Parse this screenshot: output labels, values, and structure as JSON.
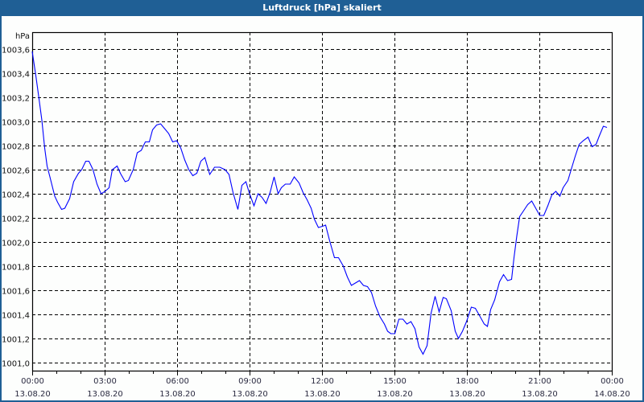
{
  "window": {
    "title": "Luftdruck [hPa] skaliert"
  },
  "colors": {
    "line": "#0000ff",
    "titlebar": "#1f5f95",
    "grid": "#000000"
  },
  "chart_data": {
    "type": "line",
    "title": "Luftdruck [hPa] skaliert",
    "ylabel": "hPa",
    "xlabel": "",
    "x_unit": "minutes since 13.08.20 00:00",
    "xlim": [
      0,
      1440
    ],
    "ylim": [
      1000.93,
      1003.74
    ],
    "grid": true,
    "yticks": [
      {
        "value": 1003.6,
        "label": "1003,6"
      },
      {
        "value": 1003.4,
        "label": "1003,4"
      },
      {
        "value": 1003.2,
        "label": "1003,2"
      },
      {
        "value": 1003.0,
        "label": "1003,0"
      },
      {
        "value": 1002.8,
        "label": "1002,8"
      },
      {
        "value": 1002.6,
        "label": "1002,6"
      },
      {
        "value": 1002.4,
        "label": "1002,4"
      },
      {
        "value": 1002.2,
        "label": "1002,2"
      },
      {
        "value": 1002.0,
        "label": "1002,0"
      },
      {
        "value": 1001.8,
        "label": "1001,8"
      },
      {
        "value": 1001.6,
        "label": "1001,6"
      },
      {
        "value": 1001.4,
        "label": "1001,4"
      },
      {
        "value": 1001.2,
        "label": "1001,2"
      },
      {
        "value": 1001.0,
        "label": "1001,0"
      }
    ],
    "xticks": [
      {
        "value": 0,
        "time": "00:00",
        "date": "13.08.20"
      },
      {
        "value": 180,
        "time": "03:00",
        "date": "13.08.20"
      },
      {
        "value": 360,
        "time": "06:00",
        "date": "13.08.20"
      },
      {
        "value": 540,
        "time": "09:00",
        "date": "13.08.20"
      },
      {
        "value": 720,
        "time": "12:00",
        "date": "13.08.20"
      },
      {
        "value": 900,
        "time": "15:00",
        "date": "13.08.20"
      },
      {
        "value": 1080,
        "time": "18:00",
        "date": "13.08.20"
      },
      {
        "value": 1260,
        "time": "21:00",
        "date": "13.08.20"
      },
      {
        "value": 1440,
        "time": "00:00",
        "date": "14.08.20"
      }
    ],
    "series": [
      {
        "name": "Luftdruck",
        "points": [
          [
            0,
            1003.58
          ],
          [
            9,
            1003.38
          ],
          [
            16,
            1003.21
          ],
          [
            24,
            1003.01
          ],
          [
            31,
            1002.78
          ],
          [
            37,
            1002.63
          ],
          [
            44,
            1002.54
          ],
          [
            56,
            1002.38
          ],
          [
            63,
            1002.33
          ],
          [
            73,
            1002.27
          ],
          [
            81,
            1002.28
          ],
          [
            93,
            1002.36
          ],
          [
            103,
            1002.5
          ],
          [
            115,
            1002.57
          ],
          [
            123,
            1002.6
          ],
          [
            133,
            1002.67
          ],
          [
            141,
            1002.67
          ],
          [
            151,
            1002.6
          ],
          [
            161,
            1002.48
          ],
          [
            171,
            1002.4
          ],
          [
            181,
            1002.42
          ],
          [
            191,
            1002.45
          ],
          [
            199,
            1002.6
          ],
          [
            211,
            1002.63
          ],
          [
            219,
            1002.57
          ],
          [
            231,
            1002.5
          ],
          [
            239,
            1002.51
          ],
          [
            251,
            1002.6
          ],
          [
            261,
            1002.74
          ],
          [
            271,
            1002.76
          ],
          [
            281,
            1002.83
          ],
          [
            291,
            1002.83
          ],
          [
            299,
            1002.93
          ],
          [
            309,
            1002.97
          ],
          [
            319,
            1002.98
          ],
          [
            329,
            1002.94
          ],
          [
            339,
            1002.9
          ],
          [
            349,
            1002.83
          ],
          [
            359,
            1002.84
          ],
          [
            369,
            1002.78
          ],
          [
            379,
            1002.68
          ],
          [
            389,
            1002.6
          ],
          [
            399,
            1002.55
          ],
          [
            409,
            1002.57
          ],
          [
            419,
            1002.67
          ],
          [
            429,
            1002.7
          ],
          [
            441,
            1002.56
          ],
          [
            453,
            1002.62
          ],
          [
            466,
            1002.62
          ],
          [
            479,
            1002.6
          ],
          [
            489,
            1002.56
          ],
          [
            499,
            1002.41
          ],
          [
            511,
            1002.27
          ],
          [
            521,
            1002.47
          ],
          [
            531,
            1002.5
          ],
          [
            539,
            1002.41
          ],
          [
            551,
            1002.3
          ],
          [
            561,
            1002.4
          ],
          [
            571,
            1002.37
          ],
          [
            581,
            1002.32
          ],
          [
            591,
            1002.41
          ],
          [
            601,
            1002.54
          ],
          [
            611,
            1002.4
          ],
          [
            619,
            1002.45
          ],
          [
            629,
            1002.48
          ],
          [
            641,
            1002.48
          ],
          [
            651,
            1002.54
          ],
          [
            663,
            1002.49
          ],
          [
            673,
            1002.41
          ],
          [
            683,
            1002.35
          ],
          [
            693,
            1002.28
          ],
          [
            701,
            1002.19
          ],
          [
            711,
            1002.12
          ],
          [
            721,
            1002.13
          ],
          [
            729,
            1002.14
          ],
          [
            739,
            1002.01
          ],
          [
            751,
            1001.87
          ],
          [
            761,
            1001.87
          ],
          [
            773,
            1001.8
          ],
          [
            783,
            1001.71
          ],
          [
            793,
            1001.64
          ],
          [
            803,
            1001.66
          ],
          [
            813,
            1001.68
          ],
          [
            823,
            1001.64
          ],
          [
            833,
            1001.63
          ],
          [
            843,
            1001.58
          ],
          [
            853,
            1001.47
          ],
          [
            864,
            1001.38
          ],
          [
            875,
            1001.32
          ],
          [
            883,
            1001.26
          ],
          [
            891,
            1001.24
          ],
          [
            901,
            1001.24
          ],
          [
            911,
            1001.36
          ],
          [
            921,
            1001.36
          ],
          [
            931,
            1001.32
          ],
          [
            941,
            1001.34
          ],
          [
            951,
            1001.28
          ],
          [
            961,
            1001.13
          ],
          [
            971,
            1001.07
          ],
          [
            981,
            1001.14
          ],
          [
            991,
            1001.41
          ],
          [
            1001,
            1001.55
          ],
          [
            1011,
            1001.42
          ],
          [
            1021,
            1001.54
          ],
          [
            1029,
            1001.53
          ],
          [
            1041,
            1001.43
          ],
          [
            1051,
            1001.26
          ],
          [
            1059,
            1001.2
          ],
          [
            1069,
            1001.26
          ],
          [
            1079,
            1001.34
          ],
          [
            1091,
            1001.46
          ],
          [
            1101,
            1001.45
          ],
          [
            1113,
            1001.38
          ],
          [
            1123,
            1001.32
          ],
          [
            1131,
            1001.3
          ],
          [
            1139,
            1001.44
          ],
          [
            1149,
            1001.52
          ],
          [
            1161,
            1001.67
          ],
          [
            1171,
            1001.73
          ],
          [
            1181,
            1001.68
          ],
          [
            1191,
            1001.69
          ],
          [
            1197,
            1001.87
          ],
          [
            1204,
            1002.05
          ],
          [
            1211,
            1002.21
          ],
          [
            1221,
            1002.26
          ],
          [
            1231,
            1002.31
          ],
          [
            1241,
            1002.34
          ],
          [
            1251,
            1002.28
          ],
          [
            1261,
            1002.22
          ],
          [
            1271,
            1002.22
          ],
          [
            1281,
            1002.3
          ],
          [
            1291,
            1002.39
          ],
          [
            1301,
            1002.42
          ],
          [
            1311,
            1002.38
          ],
          [
            1319,
            1002.45
          ],
          [
            1331,
            1002.51
          ],
          [
            1339,
            1002.6
          ],
          [
            1349,
            1002.71
          ],
          [
            1359,
            1002.81
          ],
          [
            1369,
            1002.84
          ],
          [
            1381,
            1002.87
          ],
          [
            1391,
            1002.79
          ],
          [
            1401,
            1002.81
          ],
          [
            1409,
            1002.88
          ],
          [
            1419,
            1002.96
          ],
          [
            1428,
            1002.95
          ]
        ]
      }
    ]
  }
}
